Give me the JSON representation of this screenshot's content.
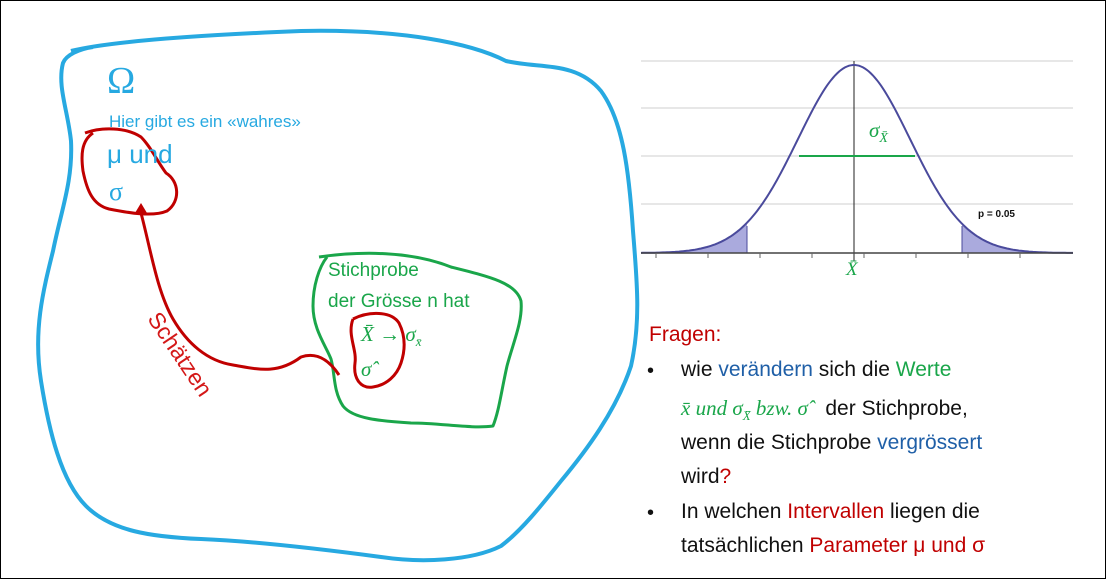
{
  "colors": {
    "omega_region": "#27a9e1",
    "param_region": "#c00000",
    "sample_region": "#1aa64a",
    "curve": "#4a4a9c",
    "question_blue": "#1f5fa7",
    "question_red": "#c00000",
    "question_green": "#1aa64a"
  },
  "population": {
    "omega_symbol": "Ω",
    "statement": "Hier gibt es ein «wahres»",
    "mu_line": "μ  und",
    "sigma_line": "σ"
  },
  "arrow_label": "Schätzen",
  "sample": {
    "line1": "Stichprobe",
    "line2": "der Grösse n hat",
    "xbar": "X̄",
    "arrow": "→",
    "sigma_xbar": "σ",
    "sigma_xbar_sub": "x̄",
    "sigma_hat": "σ̂"
  },
  "curve_chart": {
    "sigma_label": "σ",
    "sigma_label_sub": "X̄",
    "axis_label": "X̄",
    "p_label": "p = 0.05"
  },
  "questions": {
    "heading": "Fragen:",
    "bullet_symbol": "•",
    "q1": {
      "part1": "wie ",
      "part2": "verändern",
      "part3": " sich die ",
      "part4": "Werte",
      "formula_x": "x̄ und σ",
      "formula_sub": "X̄",
      "formula_rest": " bzw. σ̂",
      "part5": "   der Stichprobe,",
      "part6": "wenn die Stichprobe ",
      "part7": "vergrössert",
      "part8": "wird",
      "part9": "?"
    },
    "q2": {
      "part1": "In welchen ",
      "part2": "Intervallen",
      "part3": " liegen die",
      "part4": "tatsächlichen ",
      "part5": "Parameter μ und σ"
    }
  }
}
